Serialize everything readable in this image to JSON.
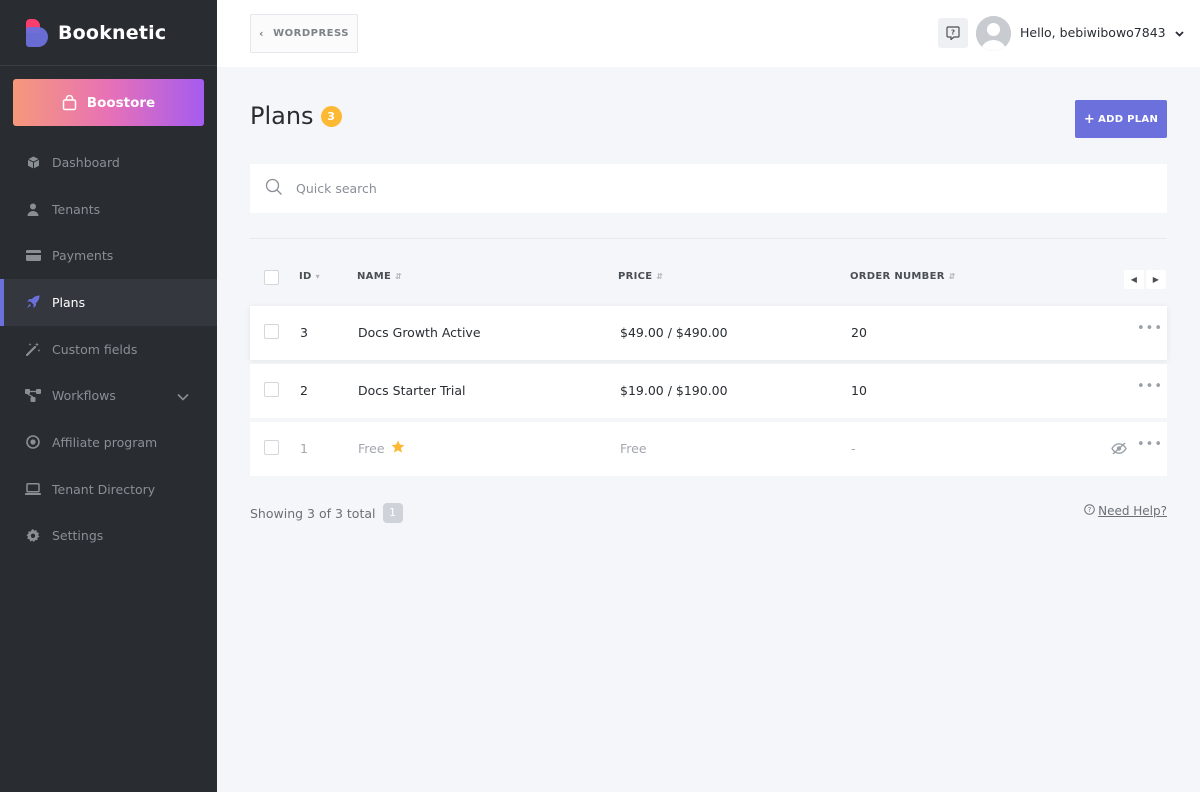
{
  "sidebar": {
    "brand": "Booknetic",
    "boostore_label": "Boostore",
    "items": [
      {
        "label": "Dashboard",
        "icon": "cube-icon"
      },
      {
        "label": "Tenants",
        "icon": "user-icon"
      },
      {
        "label": "Payments",
        "icon": "credit-card-icon"
      },
      {
        "label": "Plans",
        "icon": "rocket-icon",
        "active": true
      },
      {
        "label": "Custom fields",
        "icon": "magic-wand-icon"
      },
      {
        "label": "Workflows",
        "icon": "flow-icon",
        "expandable": true
      },
      {
        "label": "Affiliate program",
        "icon": "target-icon"
      },
      {
        "label": "Tenant Directory",
        "icon": "laptop-icon"
      },
      {
        "label": "Settings",
        "icon": "gear-icon"
      }
    ]
  },
  "topbar": {
    "wordpress_label": "WORDPRESS",
    "greeting": "Hello, bebiwibowo7843"
  },
  "page": {
    "title": "Plans",
    "count": "3",
    "add_button_label": "ADD PLAN",
    "search_placeholder": "Quick search"
  },
  "table": {
    "columns": {
      "id": "ID",
      "name": "NAME",
      "price": "PRICE",
      "order_number": "ORDER NUMBER"
    },
    "rows": [
      {
        "id": "3",
        "name": "Docs Growth Active",
        "price": "$49.00 / $490.00",
        "order_number": "20"
      },
      {
        "id": "2",
        "name": "Docs Starter Trial",
        "price": "$19.00 / $190.00",
        "order_number": "10"
      },
      {
        "id": "1",
        "name": "Free",
        "price": "Free",
        "order_number": "-",
        "default": true,
        "hidden": true
      }
    ]
  },
  "footer": {
    "showing_text": "Showing 3 of 3 total",
    "page_number": "1",
    "help_link": "Need Help?"
  },
  "colors": {
    "sidebar_bg": "#292d32",
    "accent": "#6c70dc",
    "badge": "#fdb834",
    "star": "#fdb834"
  }
}
